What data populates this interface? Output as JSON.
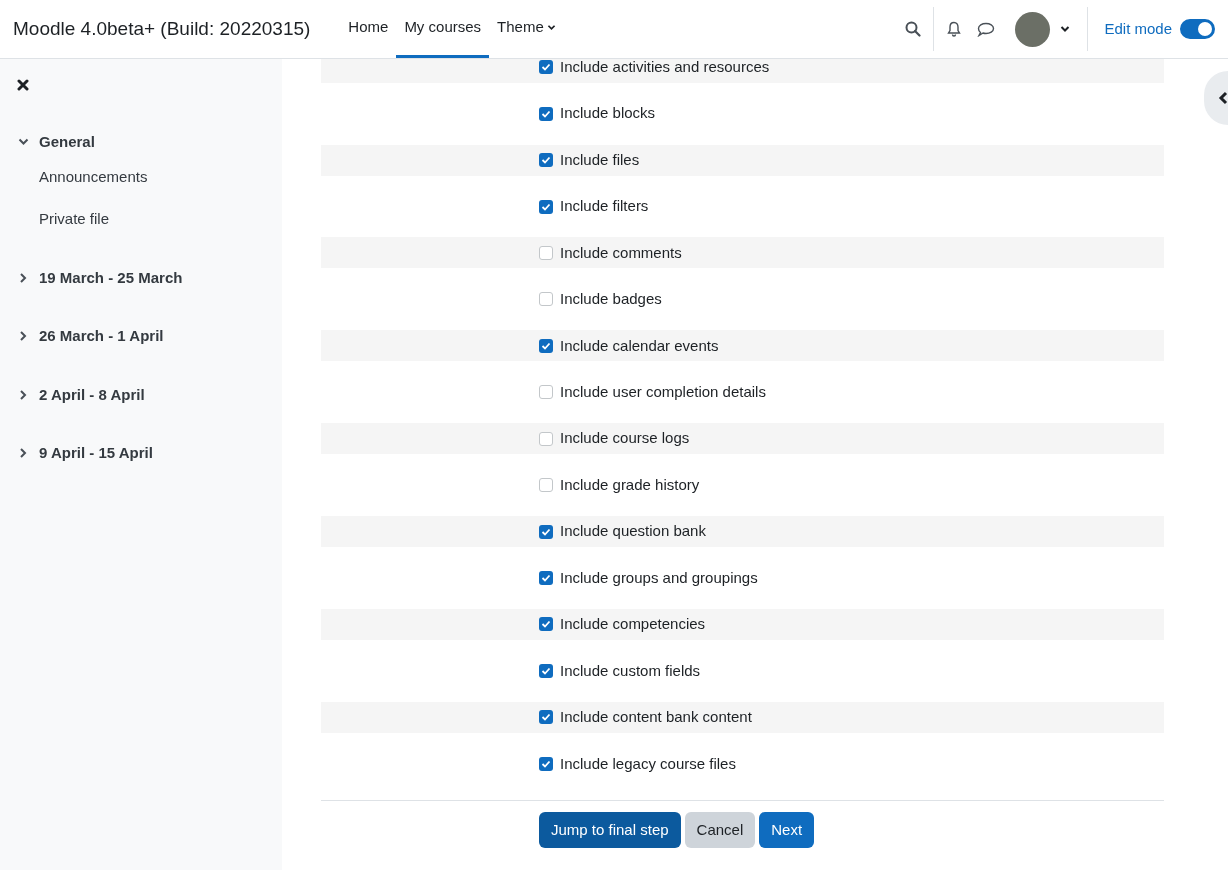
{
  "navbar": {
    "site_name": "Moodle 4.0beta+ (Build: 20220315)",
    "links": [
      {
        "label": "Home",
        "selected": false,
        "dropdown": false
      },
      {
        "label": "My courses",
        "selected": true,
        "dropdown": false
      },
      {
        "label": "Theme",
        "selected": false,
        "dropdown": true
      }
    ],
    "edit_mode": {
      "label": "Edit mode",
      "on": true
    }
  },
  "sidebar": {
    "sections": [
      {
        "title": "General",
        "expanded": true,
        "children": [
          {
            "label": "Announcements"
          },
          {
            "label": "Private file"
          }
        ]
      },
      {
        "title": "19 March - 25 March",
        "expanded": false
      },
      {
        "title": "26 March - 1 April",
        "expanded": false
      },
      {
        "title": "2 April - 8 April",
        "expanded": false
      },
      {
        "title": "9 April - 15 April",
        "expanded": false
      }
    ]
  },
  "settings": [
    {
      "label": "Include activities and resources",
      "checked": true
    },
    {
      "label": "Include blocks",
      "checked": true
    },
    {
      "label": "Include files",
      "checked": true
    },
    {
      "label": "Include filters",
      "checked": true
    },
    {
      "label": "Include comments",
      "checked": false
    },
    {
      "label": "Include badges",
      "checked": false
    },
    {
      "label": "Include calendar events",
      "checked": true
    },
    {
      "label": "Include user completion details",
      "checked": false
    },
    {
      "label": "Include course logs",
      "checked": false
    },
    {
      "label": "Include grade history",
      "checked": false
    },
    {
      "label": "Include question bank",
      "checked": true
    },
    {
      "label": "Include groups and groupings",
      "checked": true
    },
    {
      "label": "Include competencies",
      "checked": true
    },
    {
      "label": "Include custom fields",
      "checked": true
    },
    {
      "label": "Include content bank content",
      "checked": true
    },
    {
      "label": "Include legacy course files",
      "checked": true
    }
  ],
  "buttons": [
    {
      "label": "Jump to final step",
      "kind": "primary-dark"
    },
    {
      "label": "Cancel",
      "kind": "secondary"
    },
    {
      "label": "Next",
      "kind": "primary"
    }
  ]
}
